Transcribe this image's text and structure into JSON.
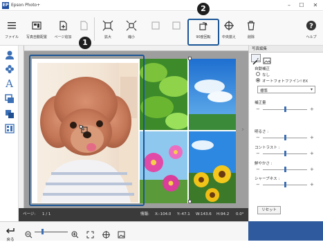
{
  "window": {
    "title": "Epson Photo+",
    "app_icon": "EP"
  },
  "toolbar": {
    "items": [
      {
        "label": "ファイル",
        "icon": "menu-icon"
      },
      {
        "label": "写真自動配置",
        "icon": "auto-layout-icon"
      },
      {
        "label": "ページ追加",
        "icon": "add-page-icon"
      },
      {
        "label": "",
        "icon": "delete-page-icon"
      },
      {
        "label": "拡大",
        "icon": "enlarge-icon"
      },
      {
        "label": "縮小",
        "icon": "shrink-icon"
      },
      {
        "label": "",
        "icon": "disabled-icon"
      },
      {
        "label": "",
        "icon": "disabled-icon"
      },
      {
        "label": "90度回転",
        "icon": "rotate-90-icon"
      },
      {
        "label": "中央揃え",
        "icon": "center-align-icon"
      },
      {
        "label": "削除",
        "icon": "trash-icon"
      },
      {
        "label": "ヘルプ",
        "icon": "help-icon"
      }
    ]
  },
  "badges": {
    "one": "1",
    "two": "2"
  },
  "status": {
    "page_label": "ページ:",
    "page_value": "1 / 1",
    "info_label": "情報:",
    "x": "X:-104.0",
    "y": "Y:-47.1",
    "w": "W:143.6",
    "h": "H:94.2",
    "angle": "0.0°"
  },
  "panel": {
    "title": "写真編集",
    "auto_correct": "自動補正",
    "opt_none": "なし",
    "opt_auto": "オートフォトファイン! EX",
    "select_value": "標準",
    "amount": "補正量",
    "brightness": "明るさ :",
    "contrast": "コントラスト :",
    "saturation": "鮮やかさ :",
    "sharpness": "シャープネス :",
    "reset": "リセット"
  },
  "bottom": {
    "back": "戻る"
  },
  "colors": {
    "accent": "#1a5596",
    "status_bg": "#3a3a3a"
  }
}
